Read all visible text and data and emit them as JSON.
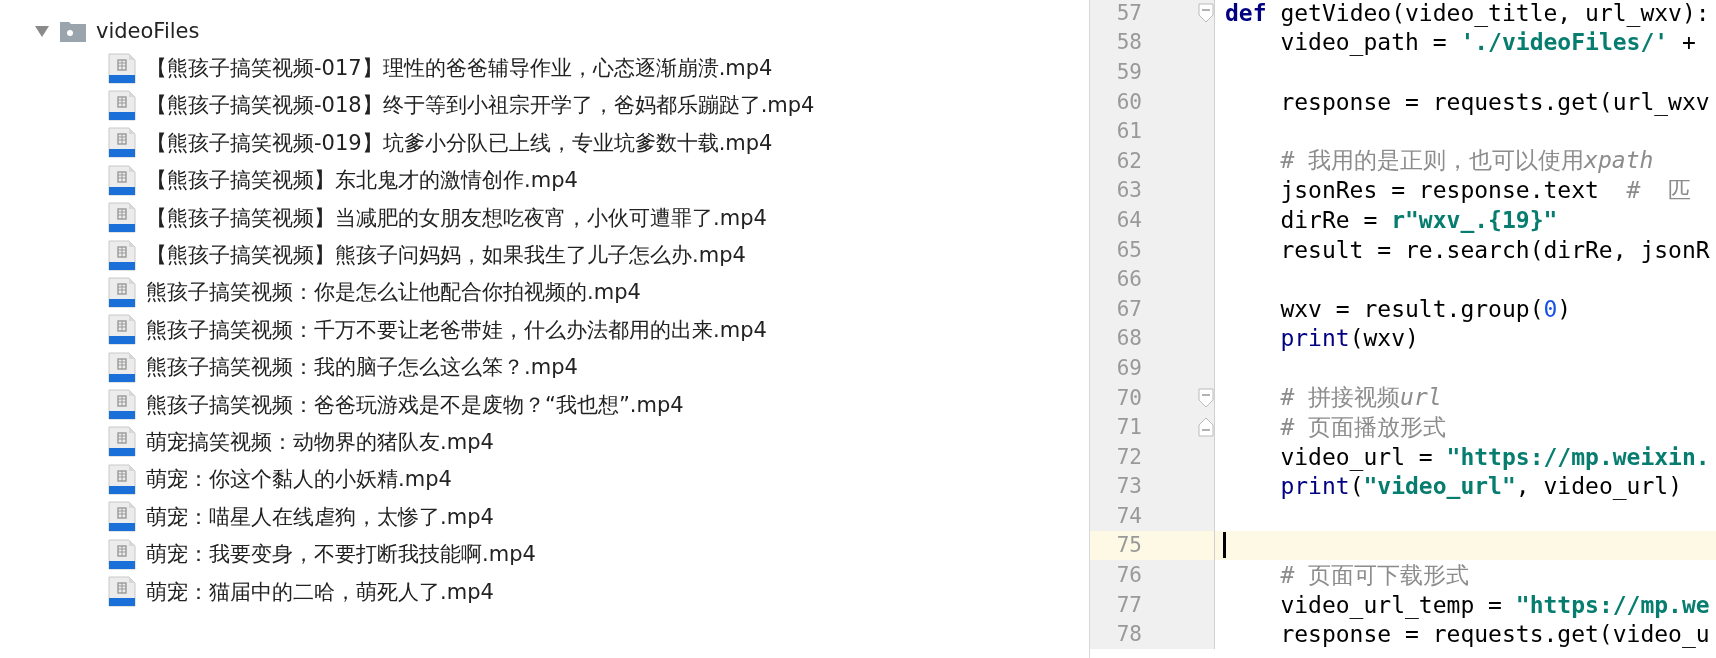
{
  "project_tree": {
    "folder": {
      "name": "videoFiles",
      "expanded": true
    },
    "files": [
      {
        "name": "【熊孩子搞笑视频-017】理性的爸爸辅导作业，心态逐渐崩溃.mp4"
      },
      {
        "name": "【熊孩子搞笑视频-018】终于等到小祖宗开学了，爸妈都乐蹦跶了.mp4"
      },
      {
        "name": "【熊孩子搞笑视频-019】坑爹小分队已上线，专业坑爹数十载.mp4"
      },
      {
        "name": "【熊孩子搞笑视频】东北鬼才的激情创作.mp4"
      },
      {
        "name": "【熊孩子搞笑视频】当减肥的女朋友想吃夜宵，小伙可遭罪了.mp4"
      },
      {
        "name": "【熊孩子搞笑视频】熊孩子问妈妈，如果我生了儿子怎么办.mp4"
      },
      {
        "name": "熊孩子搞笑视频：你是怎么让他配合你拍视频的.mp4"
      },
      {
        "name": "熊孩子搞笑视频：千万不要让老爸带娃，什么办法都用的出来.mp4"
      },
      {
        "name": "熊孩子搞笑视频：我的脑子怎么这么笨？.mp4"
      },
      {
        "name": "熊孩子搞笑视频：爸爸玩游戏是不是废物？“我也想”.mp4"
      },
      {
        "name": "萌宠搞笑视频：动物界的猪队友.mp4"
      },
      {
        "name": "萌宠：你这个黏人的小妖精.mp4"
      },
      {
        "name": "萌宠：喵星人在线虐狗，太惨了.mp4"
      },
      {
        "name": "萌宠：我要变身，不要打断我技能啊.mp4"
      },
      {
        "name": "萌宠：猫届中的二哈，萌死人了.mp4"
      }
    ]
  },
  "editor": {
    "lines": [
      {
        "number": "57",
        "current": false,
        "fold_start": true,
        "fold_end": false,
        "tokens": [
          {
            "kind": "keyword",
            "text": "def"
          },
          {
            "kind": "plain",
            "text": " getVideo(video_title, url_wxv):"
          }
        ]
      },
      {
        "number": "58",
        "current": false,
        "fold_start": false,
        "fold_end": false,
        "tokens": [
          {
            "kind": "plain",
            "text": "    video_path = "
          },
          {
            "kind": "string",
            "text": "'./videoFiles/'"
          },
          {
            "kind": "plain",
            "text": " +"
          }
        ]
      },
      {
        "number": "59",
        "current": false,
        "fold_start": false,
        "fold_end": false
      },
      {
        "number": "60",
        "current": false,
        "fold_start": false,
        "fold_end": false,
        "tokens": [
          {
            "kind": "plain",
            "text": "    response = requests.get(url_wxv"
          }
        ]
      },
      {
        "number": "61",
        "current": false,
        "fold_start": false,
        "fold_end": false
      },
      {
        "number": "62",
        "current": false,
        "fold_start": false,
        "fold_end": false,
        "tokens": [
          {
            "kind": "comment",
            "text": "    # 我用的是正则，也可以使用"
          },
          {
            "kind": "comment_italic",
            "text": "xpath"
          }
        ]
      },
      {
        "number": "63",
        "current": false,
        "fold_start": false,
        "fold_end": false,
        "tokens": [
          {
            "kind": "plain",
            "text": "    jsonRes = response.text  "
          },
          {
            "kind": "comment",
            "text": "#  匹"
          }
        ]
      },
      {
        "number": "64",
        "current": false,
        "fold_start": false,
        "fold_end": false,
        "tokens": [
          {
            "kind": "plain",
            "text": "    dirRe = "
          },
          {
            "kind": "string",
            "text": "r\"wxv_.{19}\""
          }
        ]
      },
      {
        "number": "65",
        "current": false,
        "fold_start": false,
        "fold_end": false,
        "tokens": [
          {
            "kind": "plain",
            "text": "    result = re.search(dirRe, jsonR"
          }
        ]
      },
      {
        "number": "66",
        "current": false,
        "fold_start": false,
        "fold_end": false
      },
      {
        "number": "67",
        "current": false,
        "fold_start": false,
        "fold_end": false,
        "tokens": [
          {
            "kind": "plain",
            "text": "    wxv = result.group("
          },
          {
            "kind": "number",
            "text": "0"
          },
          {
            "kind": "plain",
            "text": ")"
          }
        ]
      },
      {
        "number": "68",
        "current": false,
        "fold_start": false,
        "fold_end": false,
        "tokens": [
          {
            "kind": "builtin",
            "text": "    print"
          },
          {
            "kind": "plain",
            "text": "(wxv)"
          }
        ]
      },
      {
        "number": "69",
        "current": false,
        "fold_start": false,
        "fold_end": false
      },
      {
        "number": "70",
        "current": false,
        "fold_start": true,
        "fold_end": false,
        "tokens": [
          {
            "kind": "comment",
            "text": "    # 拼接视频"
          },
          {
            "kind": "comment_italic",
            "text": "url"
          }
        ]
      },
      {
        "number": "71",
        "current": false,
        "fold_start": false,
        "fold_end": true,
        "tokens": [
          {
            "kind": "comment",
            "text": "    # 页面播放形式"
          }
        ]
      },
      {
        "number": "72",
        "current": false,
        "fold_start": false,
        "fold_end": false,
        "tokens": [
          {
            "kind": "plain",
            "text": "    video_url = "
          },
          {
            "kind": "string",
            "text": "\"https://mp.weixin."
          }
        ]
      },
      {
        "number": "73",
        "current": false,
        "fold_start": false,
        "fold_end": false,
        "tokens": [
          {
            "kind": "builtin",
            "text": "    print"
          },
          {
            "kind": "plain",
            "text": "("
          },
          {
            "kind": "string",
            "text": "\"video_url\""
          },
          {
            "kind": "plain",
            "text": ", video_url)"
          }
        ]
      },
      {
        "number": "74",
        "current": false,
        "fold_start": false,
        "fold_end": false
      },
      {
        "number": "75",
        "current": true,
        "fold_start": false,
        "fold_end": false
      },
      {
        "number": "76",
        "current": false,
        "fold_start": false,
        "fold_end": false,
        "tokens": [
          {
            "kind": "comment",
            "text": "    # 页面可下载形式"
          }
        ]
      },
      {
        "number": "77",
        "current": false,
        "fold_start": false,
        "fold_end": false,
        "tokens": [
          {
            "kind": "plain",
            "text": "    video_url_temp = "
          },
          {
            "kind": "string",
            "text": "\"https://mp.we"
          }
        ]
      },
      {
        "number": "78",
        "current": false,
        "fold_start": false,
        "fold_end": false,
        "tokens": [
          {
            "kind": "plain",
            "text": "    response = requests.get(video_u"
          }
        ]
      }
    ]
  }
}
